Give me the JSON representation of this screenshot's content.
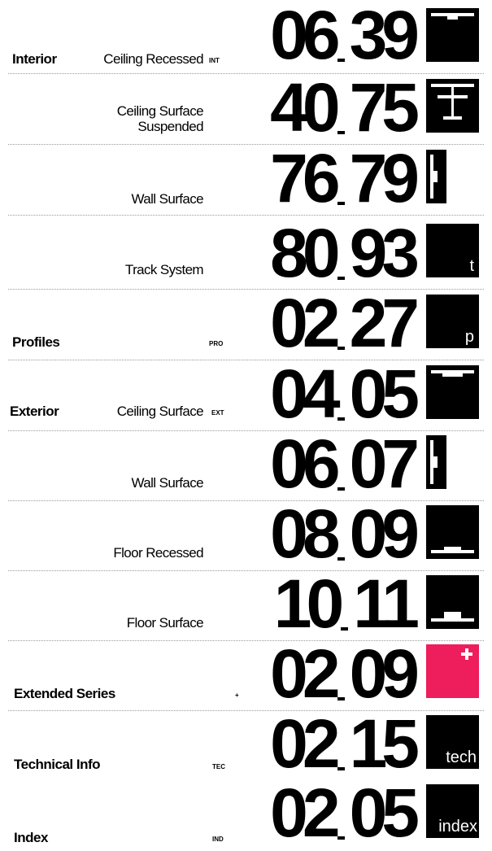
{
  "rows": [
    {
      "category": "Interior",
      "sub": "Ceiling Recessed",
      "code": "INT",
      "start": "06",
      "end": "39",
      "icon": "ceiling-recessed-icon"
    },
    {
      "category": "",
      "sub": "Ceiling Surface Suspended",
      "sub1": "Ceiling Surface",
      "sub2": "Suspended",
      "code": "",
      "start": "40",
      "end": "75",
      "icon": "ceiling-suspended-icon"
    },
    {
      "category": "",
      "sub": "Wall Surface",
      "code": "",
      "start": "76",
      "end": "79",
      "icon": "wall-surface-icon"
    },
    {
      "category": "",
      "sub": "Track System",
      "code": "",
      "start": "80",
      "end": "93",
      "icon": "track-icon",
      "box_text": "t"
    },
    {
      "category": "Profiles",
      "sub": "",
      "code": "PRO",
      "start": "02",
      "end": "27",
      "icon": "profile-icon",
      "box_text": "p"
    },
    {
      "category": "Exterior",
      "sub": "Ceiling Surface",
      "code": "EXT",
      "start": "04",
      "end": "05",
      "icon": "ceiling-surface-icon"
    },
    {
      "category": "",
      "sub": "Wall Surface",
      "code": "",
      "start": "06",
      "end": "07",
      "icon": "wall-surface-icon"
    },
    {
      "category": "",
      "sub": "Floor Recessed",
      "code": "",
      "start": "08",
      "end": "09",
      "icon": "floor-recessed-icon"
    },
    {
      "category": "",
      "sub": "Floor Surface",
      "code": "",
      "start": "10",
      "end": "11",
      "icon": "floor-surface-icon"
    },
    {
      "category": "Extended Series",
      "sub": "",
      "code": "+",
      "start": "02",
      "end": "09",
      "icon": "plus-icon",
      "box_color": "#ee1d5c"
    },
    {
      "category": "Technical Info",
      "sub": "",
      "code": "TEC",
      "start": "02",
      "end": "15",
      "icon": "tech-icon",
      "box_text": "tech"
    },
    {
      "category": "Index",
      "sub": "",
      "code": "IND",
      "start": "02",
      "end": "05",
      "icon": "index-icon",
      "box_text": "index"
    }
  ]
}
